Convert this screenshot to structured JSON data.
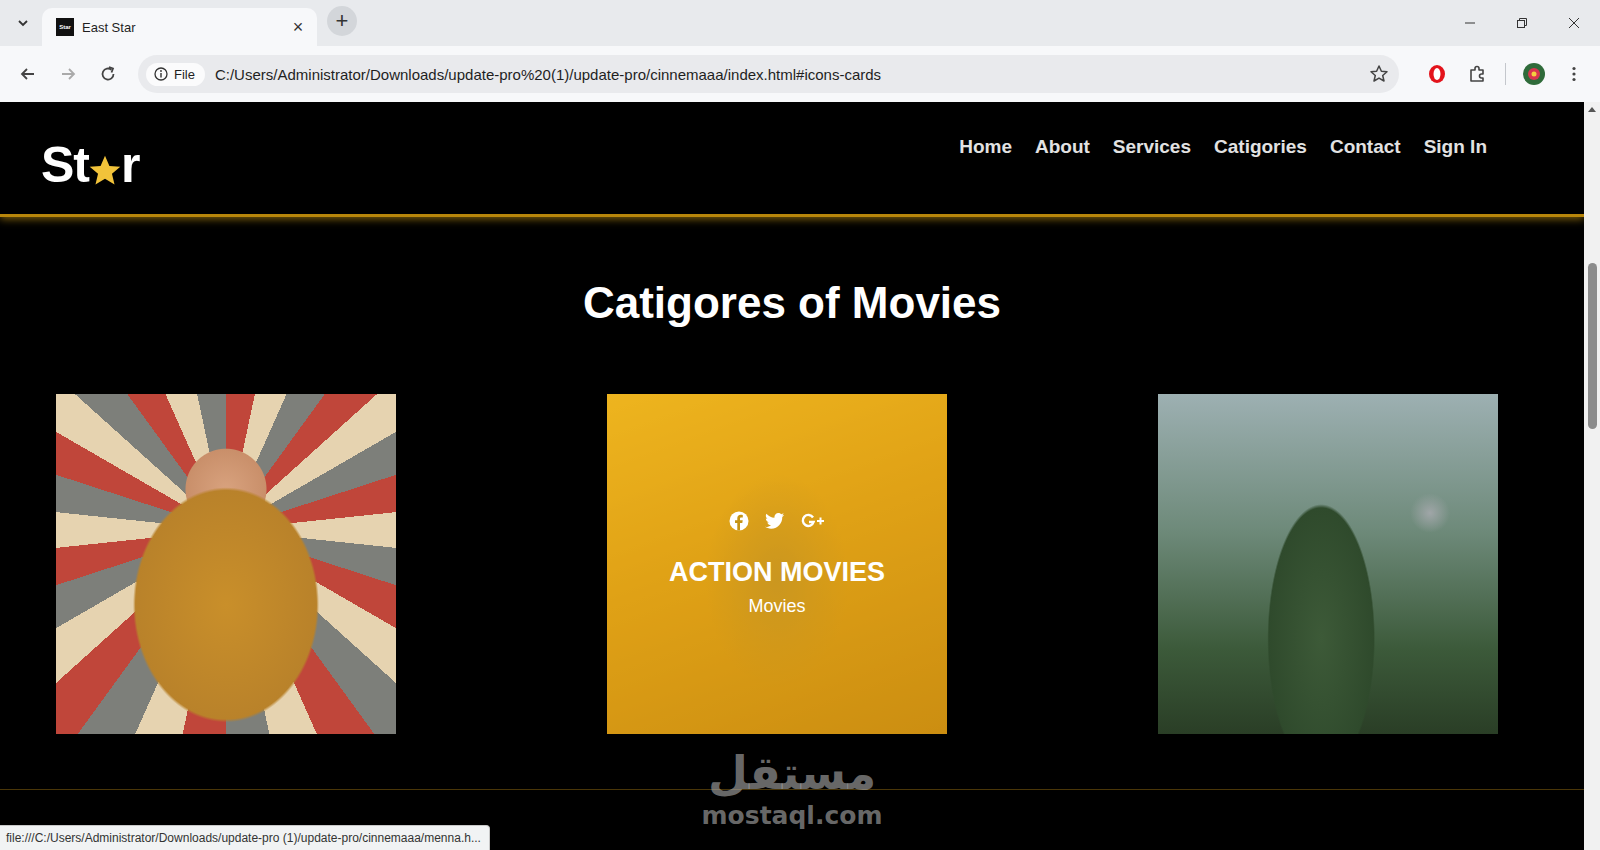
{
  "browser": {
    "tab": {
      "title": "East Star",
      "favicon_text": "Star",
      "close": "×",
      "selected": true
    },
    "new_tab": "+",
    "address": {
      "chip": "File",
      "url": "C:/Users/Administrator/Downloads/update-pro%20(1)/update-pro/cinnemaaa/index.html#icons-cards",
      "bookmarked": false
    },
    "status_url": "file:///C:/Users/Administrator/Downloads/update-pro (1)/update-pro/cinnemaaa/menna.h..."
  },
  "page": {
    "logo": {
      "before": "St",
      "after": "r"
    },
    "nav": [
      {
        "label": "Home"
      },
      {
        "label": "About"
      },
      {
        "label": "Services"
      },
      {
        "label": "Catigories"
      },
      {
        "label": "Contact"
      },
      {
        "label": "Sign In"
      }
    ],
    "heading": "Catigores of Movies",
    "cards": [
      {
        "hovered": false
      },
      {
        "hovered": true,
        "title": "ACTION MOVIES",
        "subtitle": "Movies"
      },
      {
        "hovered": false
      }
    ]
  },
  "watermark": {
    "arabic": "مستقل",
    "latin": "mostaql.com"
  }
}
